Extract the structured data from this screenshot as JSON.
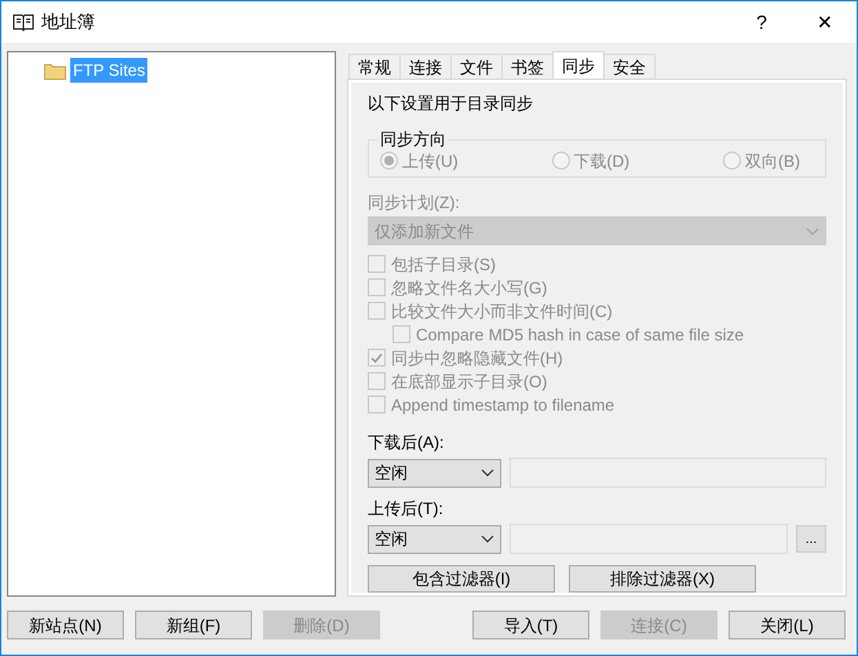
{
  "window": {
    "title": "地址簿",
    "help": "?",
    "close": "✕"
  },
  "tree": [
    {
      "label": "FTP Sites",
      "selected": true
    }
  ],
  "tabs": [
    {
      "label": "常规",
      "selected": false
    },
    {
      "label": "连接",
      "selected": false
    },
    {
      "label": "文件",
      "selected": false
    },
    {
      "label": "书签",
      "selected": false
    },
    {
      "label": "同步",
      "selected": true
    },
    {
      "label": "安全",
      "selected": false
    }
  ],
  "sync": {
    "intro": "以下设置用于目录同步",
    "direction": {
      "legend": "同步方向",
      "options": [
        {
          "label": "上传(U)",
          "selected": true
        },
        {
          "label": "下载(D)",
          "selected": false
        },
        {
          "label": "双向(B)",
          "selected": false
        }
      ]
    },
    "schedule": {
      "label": "同步计划(Z):",
      "value": "仅添加新文件",
      "disabled": true
    },
    "options": [
      {
        "label": "包括子目录(S)",
        "checked": false
      },
      {
        "label": "忽略文件名大小写(G)",
        "checked": false
      },
      {
        "label": "比较文件大小而非文件时间(C)",
        "checked": false,
        "children": [
          {
            "label": "Compare MD5 hash in case of same file size",
            "checked": false
          }
        ]
      },
      {
        "label": "同步中忽略隐藏文件(H)",
        "checked": true
      },
      {
        "label": "在底部显示子目录(O)",
        "checked": false
      },
      {
        "label": "Append timestamp to filename",
        "checked": false
      }
    ],
    "after_download": {
      "label": "下载后(A):",
      "value": "空闲",
      "browse": false
    },
    "after_upload": {
      "label": "上传后(T):",
      "value": "空闲",
      "browse": true,
      "browse_label": "..."
    },
    "filters": [
      "包含过滤器(I)",
      "排除过滤器(X)"
    ]
  },
  "buttons": [
    {
      "label": "新站点(N)",
      "disabled": false
    },
    {
      "label": "新组(F)",
      "disabled": false
    },
    {
      "label": "删除(D)",
      "disabled": true
    },
    {
      "label": "导入(T)",
      "disabled": false
    },
    {
      "label": "连接(C)",
      "disabled": true
    },
    {
      "label": "关闭(L)",
      "disabled": false
    }
  ]
}
